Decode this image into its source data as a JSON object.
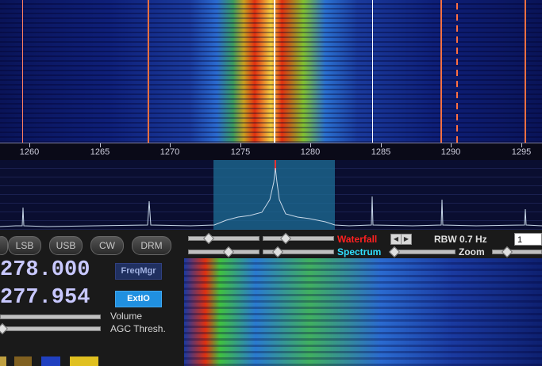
{
  "freq_axis": {
    "ticks": [
      "1260",
      "1265",
      "1270",
      "1275",
      "1280",
      "1285",
      "1290",
      "1295"
    ]
  },
  "modes": [
    "LSB",
    "USB",
    "CW",
    "DRM"
  ],
  "frequencies": {
    "lo": "278.000",
    "tune": "277.954"
  },
  "buttons": {
    "freqmgr": "FreqMgr",
    "extio": "ExtIO"
  },
  "labels": {
    "volume": "Volume",
    "agc": "AGC Thresh.",
    "waterfall": "Waterfall",
    "spectrum": "Spectrum",
    "rbw": "RBW  0.7 Hz",
    "zoom": "Zoom",
    "zoom_value": "1"
  },
  "colors": {
    "waterfall_label": "#ff2020",
    "spectrum_label": "#30e0ff",
    "freq_digits": "#c8c8ff",
    "extio_bg": "#2090e0"
  }
}
